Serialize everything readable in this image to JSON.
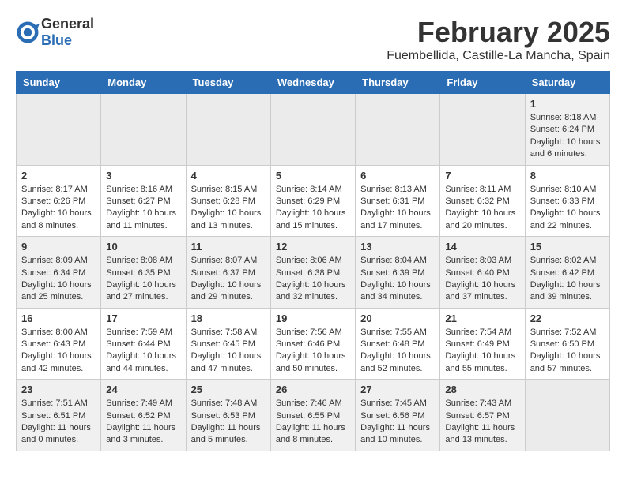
{
  "header": {
    "logo_general": "General",
    "logo_blue": "Blue",
    "month_title": "February 2025",
    "subtitle": "Fuembellida, Castille-La Mancha, Spain"
  },
  "weekdays": [
    "Sunday",
    "Monday",
    "Tuesday",
    "Wednesday",
    "Thursday",
    "Friday",
    "Saturday"
  ],
  "weeks": [
    [
      {
        "day": "",
        "info": ""
      },
      {
        "day": "",
        "info": ""
      },
      {
        "day": "",
        "info": ""
      },
      {
        "day": "",
        "info": ""
      },
      {
        "day": "",
        "info": ""
      },
      {
        "day": "",
        "info": ""
      },
      {
        "day": "1",
        "info": "Sunrise: 8:18 AM\nSunset: 6:24 PM\nDaylight: 10 hours\nand 6 minutes."
      }
    ],
    [
      {
        "day": "2",
        "info": "Sunrise: 8:17 AM\nSunset: 6:26 PM\nDaylight: 10 hours\nand 8 minutes."
      },
      {
        "day": "3",
        "info": "Sunrise: 8:16 AM\nSunset: 6:27 PM\nDaylight: 10 hours\nand 11 minutes."
      },
      {
        "day": "4",
        "info": "Sunrise: 8:15 AM\nSunset: 6:28 PM\nDaylight: 10 hours\nand 13 minutes."
      },
      {
        "day": "5",
        "info": "Sunrise: 8:14 AM\nSunset: 6:29 PM\nDaylight: 10 hours\nand 15 minutes."
      },
      {
        "day": "6",
        "info": "Sunrise: 8:13 AM\nSunset: 6:31 PM\nDaylight: 10 hours\nand 17 minutes."
      },
      {
        "day": "7",
        "info": "Sunrise: 8:11 AM\nSunset: 6:32 PM\nDaylight: 10 hours\nand 20 minutes."
      },
      {
        "day": "8",
        "info": "Sunrise: 8:10 AM\nSunset: 6:33 PM\nDaylight: 10 hours\nand 22 minutes."
      }
    ],
    [
      {
        "day": "9",
        "info": "Sunrise: 8:09 AM\nSunset: 6:34 PM\nDaylight: 10 hours\nand 25 minutes."
      },
      {
        "day": "10",
        "info": "Sunrise: 8:08 AM\nSunset: 6:35 PM\nDaylight: 10 hours\nand 27 minutes."
      },
      {
        "day": "11",
        "info": "Sunrise: 8:07 AM\nSunset: 6:37 PM\nDaylight: 10 hours\nand 29 minutes."
      },
      {
        "day": "12",
        "info": "Sunrise: 8:06 AM\nSunset: 6:38 PM\nDaylight: 10 hours\nand 32 minutes."
      },
      {
        "day": "13",
        "info": "Sunrise: 8:04 AM\nSunset: 6:39 PM\nDaylight: 10 hours\nand 34 minutes."
      },
      {
        "day": "14",
        "info": "Sunrise: 8:03 AM\nSunset: 6:40 PM\nDaylight: 10 hours\nand 37 minutes."
      },
      {
        "day": "15",
        "info": "Sunrise: 8:02 AM\nSunset: 6:42 PM\nDaylight: 10 hours\nand 39 minutes."
      }
    ],
    [
      {
        "day": "16",
        "info": "Sunrise: 8:00 AM\nSunset: 6:43 PM\nDaylight: 10 hours\nand 42 minutes."
      },
      {
        "day": "17",
        "info": "Sunrise: 7:59 AM\nSunset: 6:44 PM\nDaylight: 10 hours\nand 44 minutes."
      },
      {
        "day": "18",
        "info": "Sunrise: 7:58 AM\nSunset: 6:45 PM\nDaylight: 10 hours\nand 47 minutes."
      },
      {
        "day": "19",
        "info": "Sunrise: 7:56 AM\nSunset: 6:46 PM\nDaylight: 10 hours\nand 50 minutes."
      },
      {
        "day": "20",
        "info": "Sunrise: 7:55 AM\nSunset: 6:48 PM\nDaylight: 10 hours\nand 52 minutes."
      },
      {
        "day": "21",
        "info": "Sunrise: 7:54 AM\nSunset: 6:49 PM\nDaylight: 10 hours\nand 55 minutes."
      },
      {
        "day": "22",
        "info": "Sunrise: 7:52 AM\nSunset: 6:50 PM\nDaylight: 10 hours\nand 57 minutes."
      }
    ],
    [
      {
        "day": "23",
        "info": "Sunrise: 7:51 AM\nSunset: 6:51 PM\nDaylight: 11 hours\nand 0 minutes."
      },
      {
        "day": "24",
        "info": "Sunrise: 7:49 AM\nSunset: 6:52 PM\nDaylight: 11 hours\nand 3 minutes."
      },
      {
        "day": "25",
        "info": "Sunrise: 7:48 AM\nSunset: 6:53 PM\nDaylight: 11 hours\nand 5 minutes."
      },
      {
        "day": "26",
        "info": "Sunrise: 7:46 AM\nSunset: 6:55 PM\nDaylight: 11 hours\nand 8 minutes."
      },
      {
        "day": "27",
        "info": "Sunrise: 7:45 AM\nSunset: 6:56 PM\nDaylight: 11 hours\nand 10 minutes."
      },
      {
        "day": "28",
        "info": "Sunrise: 7:43 AM\nSunset: 6:57 PM\nDaylight: 11 hours\nand 13 minutes."
      },
      {
        "day": "",
        "info": ""
      }
    ]
  ]
}
